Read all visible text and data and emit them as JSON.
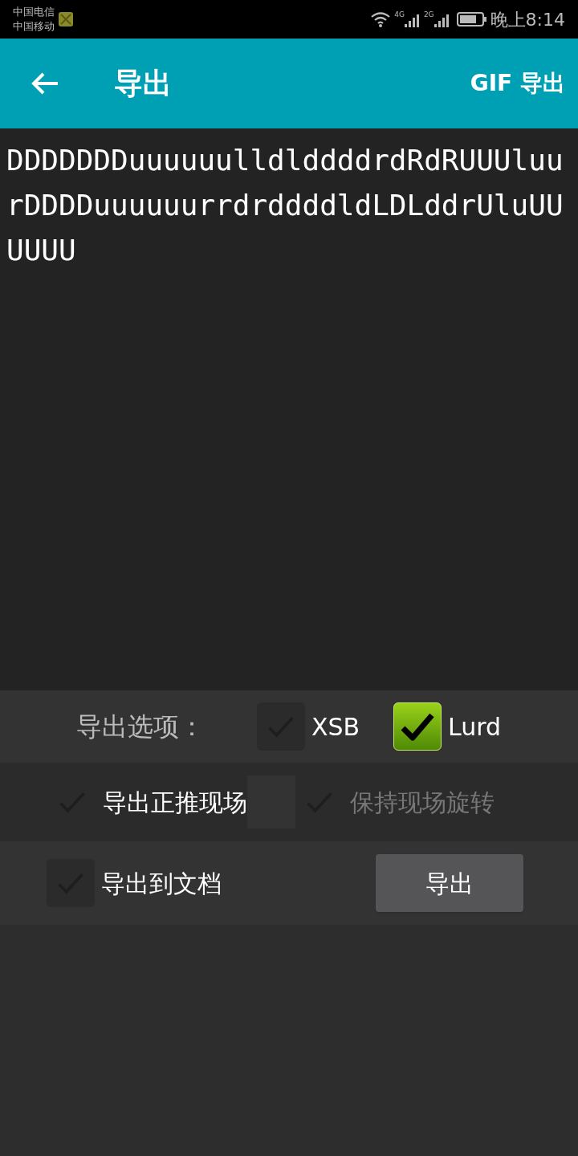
{
  "status_bar": {
    "carriers": [
      "中国电信",
      "中国移动"
    ],
    "network_1": "4G",
    "network_2": "2G",
    "time": "晚上8:14"
  },
  "toolbar": {
    "title": "导出",
    "action": "GIF 导出"
  },
  "solution_text": "DDDDDDDuuuuuulldlddddrdRdRUUUluurDDDDuuuuuurrdrddddldLDLddrUluUUUUUU",
  "options_label": "导出选项：",
  "formats": [
    {
      "label": "XSB",
      "checked": false
    },
    {
      "label": "Lurd",
      "checked": true
    }
  ],
  "row_options": [
    {
      "label": "导出正推现场",
      "checked": false,
      "disabled": false
    },
    {
      "label": "保持现场旋转",
      "checked": false,
      "disabled": true
    }
  ],
  "file_option": {
    "label": "导出到文档",
    "checked": false
  },
  "export_button": "导出"
}
